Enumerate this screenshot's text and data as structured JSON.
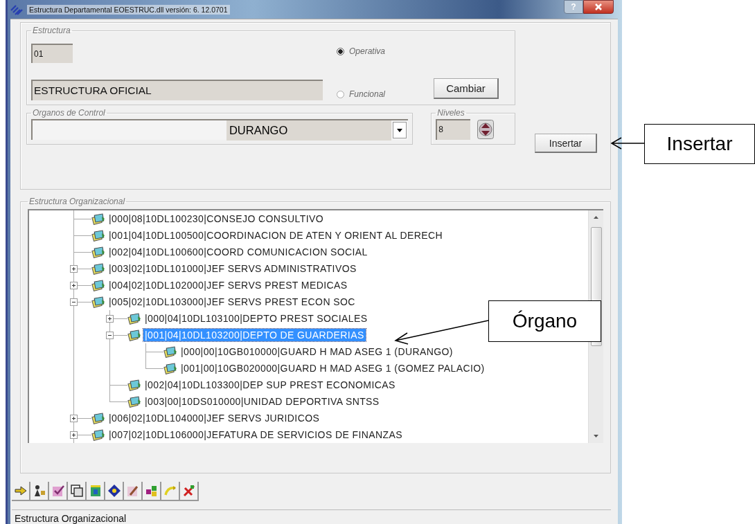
{
  "window": {
    "title": "Estructura Departamental EOESTRUC.dll  versión: 6. 12.0701",
    "help": "?"
  },
  "estructura": {
    "legend": "Estructura",
    "code": "01",
    "name": "ESTRUCTURA OFICIAL",
    "options": [
      {
        "label": "Operativa",
        "selected": true
      },
      {
        "label": "Funcional",
        "selected": false
      }
    ],
    "change_button": "Cambiar"
  },
  "organos": {
    "legend": "Organos de Control",
    "value": "DURANGO"
  },
  "niveles": {
    "legend": "Niveles",
    "value": "8"
  },
  "insert_button": "Insertar",
  "tree": {
    "legend": "Estructura Organizacional",
    "nodes": [
      {
        "label": "|000|08|10DL100230|CONSEJO CONSULTIVO",
        "selected": false
      },
      {
        "label": "|001|04|10DL100500|COORDINACION DE ATEN Y ORIENT AL DERECH",
        "selected": false
      },
      {
        "label": "|002|04|10DL100600|COORD COMUNICACION SOCIAL",
        "selected": false
      },
      {
        "label": "|003|02|10DL101000|JEF SERVS ADMINISTRATIVOS",
        "expanded": false,
        "selected": false
      },
      {
        "label": "|004|02|10DL102000|JEF SERVS PREST MEDICAS",
        "expanded": false,
        "selected": false
      },
      {
        "label": "|005|02|10DL103000|JEF SERVS PREST ECON SOC",
        "expanded": true,
        "selected": false,
        "children": [
          {
            "label": "|000|04|10DL103100|DEPTO PREST SOCIALES",
            "expanded": false,
            "selected": false
          },
          {
            "label": "|001|04|10DL103200|DEPTO DE GUARDERIAS",
            "expanded": true,
            "selected": true,
            "children": [
              {
                "label": "|000|00|10GB010000|GUARD H MAD ASEG 1 (DURANGO)",
                "selected": false
              },
              {
                "label": "|001|00|10GB020000|GUARD H MAD ASEG 1 (GOMEZ PALACIO)",
                "selected": false
              }
            ]
          },
          {
            "label": "|002|04|10DL103300|DEP SUP PREST ECONOMICAS",
            "selected": false
          },
          {
            "label": "|003|00|10DS010000|UNIDAD DEPORTIVA SNTSS",
            "selected": false
          }
        ]
      },
      {
        "label": "|006|02|10DL104000|JEF SERVS JURIDICOS",
        "expanded": false,
        "selected": false
      },
      {
        "label": "|007|02|10DL106000|JEFATURA DE SERVICIOS DE FINANZAS",
        "expanded": false,
        "selected": false
      }
    ]
  },
  "status_bar": "Estructura Organizacional",
  "callouts": [
    {
      "text": "Insertar"
    },
    {
      "text": "Órgano"
    }
  ]
}
